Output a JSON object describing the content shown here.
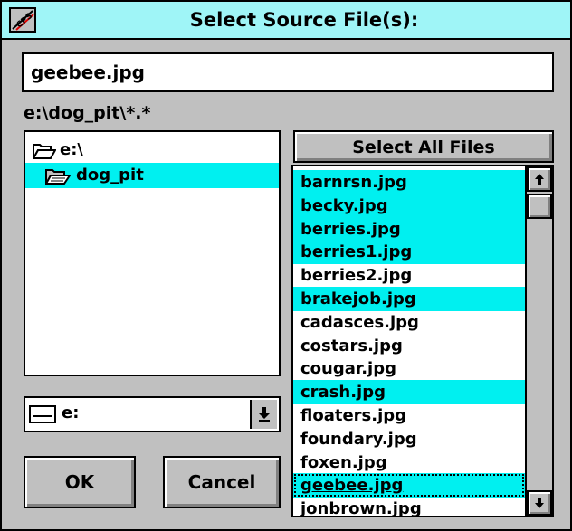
{
  "window": {
    "title": "Select Source File(s):",
    "system_menu_icon": "cps-logo-icon"
  },
  "filename_field": {
    "value": "geebee.jpg"
  },
  "current_path": "e:\\dog_pit\\*.*",
  "directories": [
    {
      "name": "e:\\",
      "icon": "open-folder-icon",
      "selected": false
    },
    {
      "name": "dog_pit",
      "icon": "open-folder-icon",
      "selected": true
    }
  ],
  "drive_select": {
    "value": "e:"
  },
  "buttons": {
    "select_all": "Select All Files",
    "ok": "OK",
    "cancel": "Cancel"
  },
  "files": [
    {
      "name": "barnrsn.jpg",
      "selected": true
    },
    {
      "name": "becky.jpg",
      "selected": true
    },
    {
      "name": "berries.jpg",
      "selected": true
    },
    {
      "name": "berries1.jpg",
      "selected": true
    },
    {
      "name": "berries2.jpg",
      "selected": false
    },
    {
      "name": "brakejob.jpg",
      "selected": true
    },
    {
      "name": "cadasces.jpg",
      "selected": false
    },
    {
      "name": "costars.jpg",
      "selected": false
    },
    {
      "name": "cougar.jpg",
      "selected": false
    },
    {
      "name": "crash.jpg",
      "selected": true
    },
    {
      "name": "floaters.jpg",
      "selected": false
    },
    {
      "name": "foundary.jpg",
      "selected": false
    },
    {
      "name": "foxen.jpg",
      "selected": false
    },
    {
      "name": "geebee.jpg",
      "selected": true,
      "focused": true
    },
    {
      "name": "jonbrown.jpg",
      "selected": false
    }
  ],
  "colors": {
    "title_bar": "#9ff5f7",
    "selection": "#00f0f0",
    "face": "#c0c0c0"
  }
}
